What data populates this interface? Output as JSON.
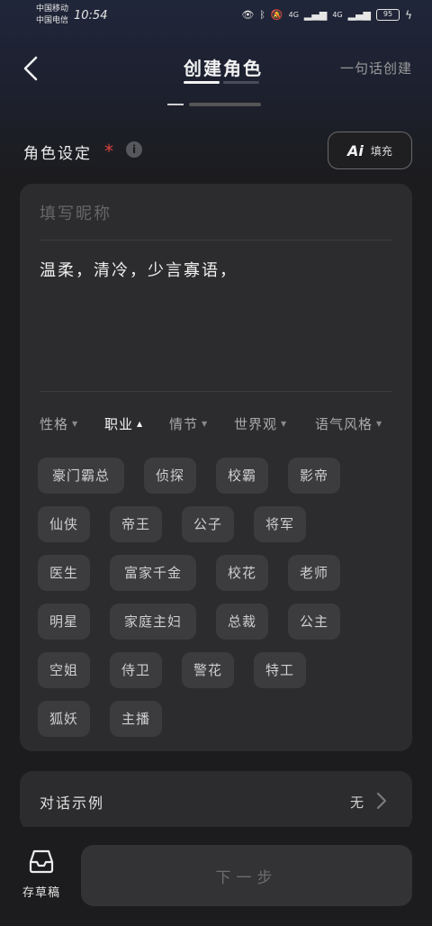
{
  "status_bar": {
    "carrier1": "中国移动",
    "carrier2": "中国电信",
    "time": "10:54",
    "network1": "4G",
    "network2": "4G",
    "battery": "95"
  },
  "nav": {
    "title": "创建角色",
    "quick_create": "一句话创建"
  },
  "role_settings": {
    "label": "角色设定",
    "required": "*",
    "info": "i",
    "ai_fill_mark": "Ai",
    "ai_fill_label": "填充"
  },
  "card": {
    "nickname_placeholder": "填写昵称",
    "nickname_value": "",
    "description": "温柔，清冷，少言寡语，"
  },
  "category_tabs": [
    {
      "label": "性格",
      "caret": "▼"
    },
    {
      "label": "职业",
      "caret": "▲"
    },
    {
      "label": "情节",
      "caret": "▼"
    },
    {
      "label": "世界观",
      "caret": "▼"
    },
    {
      "label": "语气风格",
      "caret": "▼"
    }
  ],
  "chips": [
    "豪门霸总",
    "侦探",
    "校霸",
    "影帝",
    "仙侠",
    "帝王",
    "公子",
    "将军",
    "医生",
    "富家千金",
    "校花",
    "老师",
    "明星",
    "家庭主妇",
    "总裁",
    "公主",
    "空姐",
    "侍卫",
    "警花",
    "特工",
    "狐妖",
    "主播"
  ],
  "dialog_example": {
    "label": "对话示例",
    "value": "无"
  },
  "bottom": {
    "drafts_label": "存草稿",
    "next_label": "下一步"
  },
  "colors": {
    "background": "#1c1c1e",
    "card": "#2c2c2e",
    "chip": "#3c3c3f",
    "required": "#d9413e"
  }
}
